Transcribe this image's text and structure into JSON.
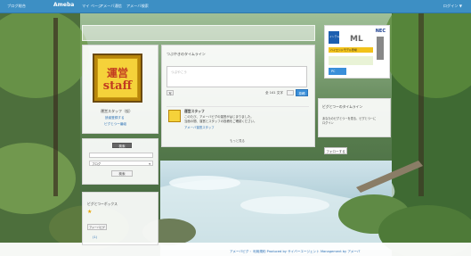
{
  "topbar": {
    "items": [
      "ブログ総合",
      "",
      "マイ ページ",
      "アメーバ通信",
      "アメーバ検索"
    ],
    "logo": "Ameba",
    "right": "ログイン ▼"
  },
  "profile": {
    "image_text_1": "運営",
    "image_text_2": "staff",
    "name": "運営スタッフ（仮）",
    "link1": "読者登録する",
    "link2": "ピグとつー番組"
  },
  "compose": {
    "heading": "つぶやきのタイムライン",
    "placeholder": "つぶやこう",
    "counter": "全 141 文字",
    "submit": "投稿",
    "left_button": "写"
  },
  "notice": {
    "title": "運営スタッフ",
    "line1": "このたび、アメーバピグの運営がはじまりました。",
    "line2": "当面の間、運営とスタッフの投稿をご確認ください。",
    "link": "アメーバ運営スタッフ",
    "more": "もっと見る"
  },
  "search": {
    "heading": "検索",
    "placeholder": "",
    "select": "ブログ",
    "button": "検索"
  },
  "freearea": {
    "heading": "ピグとつーボックス",
    "tag": "アメーバピグ",
    "count": "(1)"
  },
  "right_timeline": {
    "heading": "ピグとつーのタイムライン",
    "text1": "あなたのピグとつーを見る、ピグとつーに",
    "text2": "ログイン"
  },
  "right_button": "フォローする",
  "ad": {
    "brand": "NEC",
    "model": "ML",
    "caption": "ハイエンドモデル登場",
    "badge": "インテル",
    "price": "PC"
  },
  "footer": "アメーバピグ・ 利用規約 Produced by サイバーエージェント  Management by アメーバ"
}
